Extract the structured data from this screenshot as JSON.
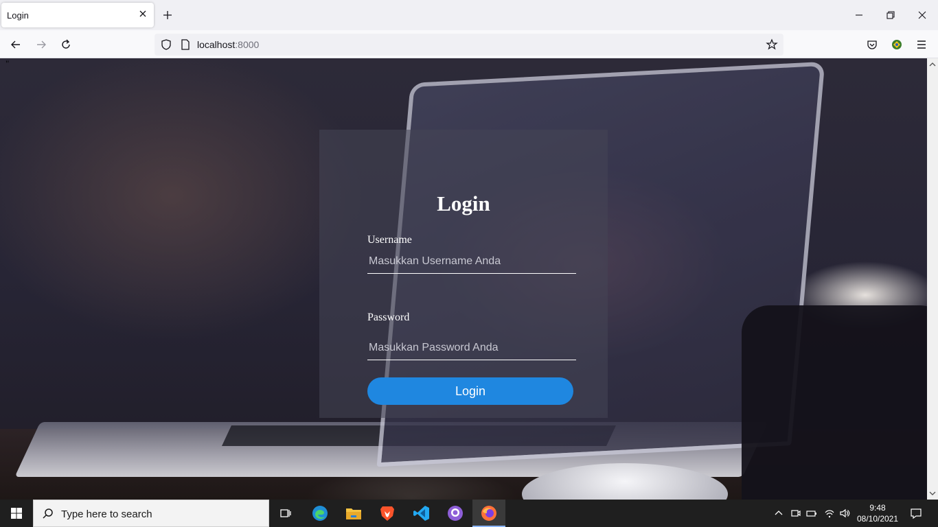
{
  "browser": {
    "tab": {
      "title": "Login",
      "icon": "close-icon"
    },
    "url": {
      "host": "localhost",
      "port": ":8000"
    }
  },
  "page": {
    "stray_text": "\"",
    "login": {
      "title": "Login",
      "username_label": "Username",
      "username_placeholder": "Masukkan Username Anda",
      "password_label": "Password",
      "password_placeholder": "Masukkan Password Anda",
      "button_label": "Login",
      "button_color": "#1f87e0"
    }
  },
  "taskbar": {
    "search_placeholder": "Type here to search",
    "apps": [
      "task-view",
      "edge",
      "file-explorer",
      "brave",
      "vscode",
      "github-desktop",
      "firefox"
    ],
    "time": "9:48",
    "date": "08/10/2021"
  }
}
